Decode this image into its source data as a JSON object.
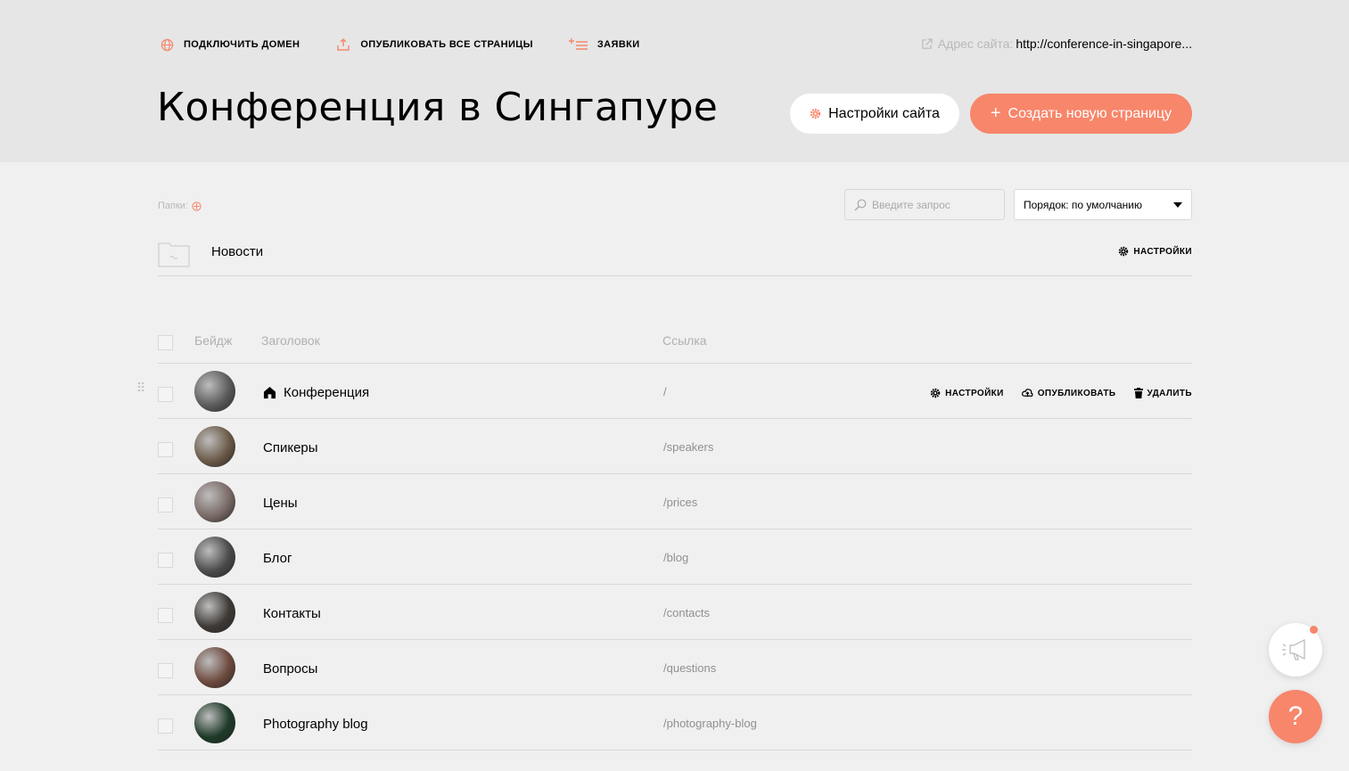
{
  "colors": {
    "accent": "#f7866b",
    "header_bg": "#e6e6e6",
    "body_bg": "#f0f0f0"
  },
  "topnav": {
    "connect_domain": "ПОДКЛЮЧИТЬ ДОМЕН",
    "publish_all": "ОПУБЛИКОВАТЬ ВСЕ СТРАНИЦЫ",
    "requests": "ЗАЯВКИ"
  },
  "site_address": {
    "label": "Адрес сайта:",
    "url": "http://conference-in-singapore..."
  },
  "page_title": "Конференция в Сингапуре",
  "buttons": {
    "site_settings": "Настройки сайта",
    "create_page": "Создать новую страницу"
  },
  "folders": {
    "label": "Папки:",
    "items": [
      {
        "name": "Новости",
        "settings": "НАСТРОЙКИ"
      }
    ]
  },
  "search": {
    "placeholder": "Введите запрос"
  },
  "sort": {
    "value": "Порядок: по умолчанию"
  },
  "table": {
    "headers": {
      "badge": "Бейдж",
      "title": "Заголовок",
      "link": "Ссылка"
    },
    "rows": [
      {
        "title": "Конференция",
        "link": "/",
        "home": true,
        "thumb": "#5a5a5a"
      },
      {
        "title": "Спикеры",
        "link": "/speakers",
        "thumb": "#6b5a48"
      },
      {
        "title": "Цены",
        "link": "/prices",
        "thumb": "#7a6a66"
      },
      {
        "title": "Блог",
        "link": "/blog",
        "thumb": "#4a4a4a"
      },
      {
        "title": "Контакты",
        "link": "/contacts",
        "thumb": "#3e3a36"
      },
      {
        "title": "Вопросы",
        "link": "/questions",
        "thumb": "#6e4a3e"
      },
      {
        "title": "Photography blog",
        "link": "/photography-blog",
        "thumb": "#1e3a28"
      }
    ],
    "row_actions": {
      "settings": "НАСТРОЙКИ",
      "publish": "ОПУБЛИКОВАТЬ",
      "delete": "УДАЛИТЬ"
    }
  },
  "help": {
    "label": "?"
  }
}
